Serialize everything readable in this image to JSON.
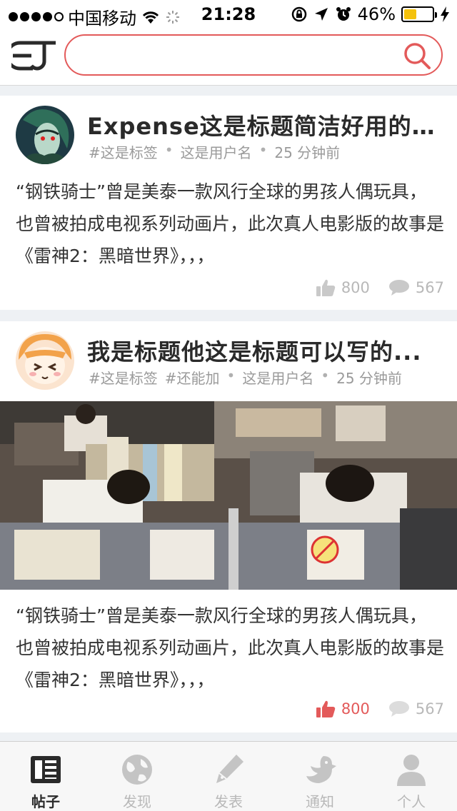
{
  "status_bar": {
    "carrier": "中国移动",
    "time": "21:28",
    "battery": "46%",
    "battery_fraction": 0.46
  },
  "search": {
    "placeholder": ""
  },
  "posts": [
    {
      "title": "Expense这是标题简洁好用的...",
      "tags": [
        "#这是标签"
      ],
      "author": "这是用户名",
      "time": "25 分钟前",
      "body": "“钢铁骑士”曾是美泰一款风行全球的男孩人偶玩具，也曾被拍成电视系列动画片，此次真人电影版的故事是《雷神2：黑暗世界》，，，",
      "likes": "800",
      "comments": "567",
      "liked": false
    },
    {
      "title": "我是标题他这是标题可以写的...",
      "tags": [
        "#这是标签",
        "#还能加"
      ],
      "author": "这是用户名",
      "time": "25 分钟前",
      "body": "“钢铁骑士”曾是美泰一款风行全球的男孩人偶玩具，也曾被拍成电视系列动画片，此次真人电影版的故事是《雷神2：黑暗世界》，，，",
      "likes": "800",
      "comments": "567",
      "liked": true
    }
  ],
  "tabs": [
    {
      "label": "帖子",
      "icon": "newspaper-icon",
      "active": true
    },
    {
      "label": "发现",
      "icon": "globe-icon",
      "active": false
    },
    {
      "label": "发表",
      "icon": "pen-icon",
      "active": false
    },
    {
      "label": "通知",
      "icon": "bird-icon",
      "active": false
    },
    {
      "label": "个人",
      "icon": "person-icon",
      "active": false
    }
  ],
  "colors": {
    "accent": "#e35a5a",
    "muted": "#b8b8b8",
    "text": "#2a2a2a"
  }
}
